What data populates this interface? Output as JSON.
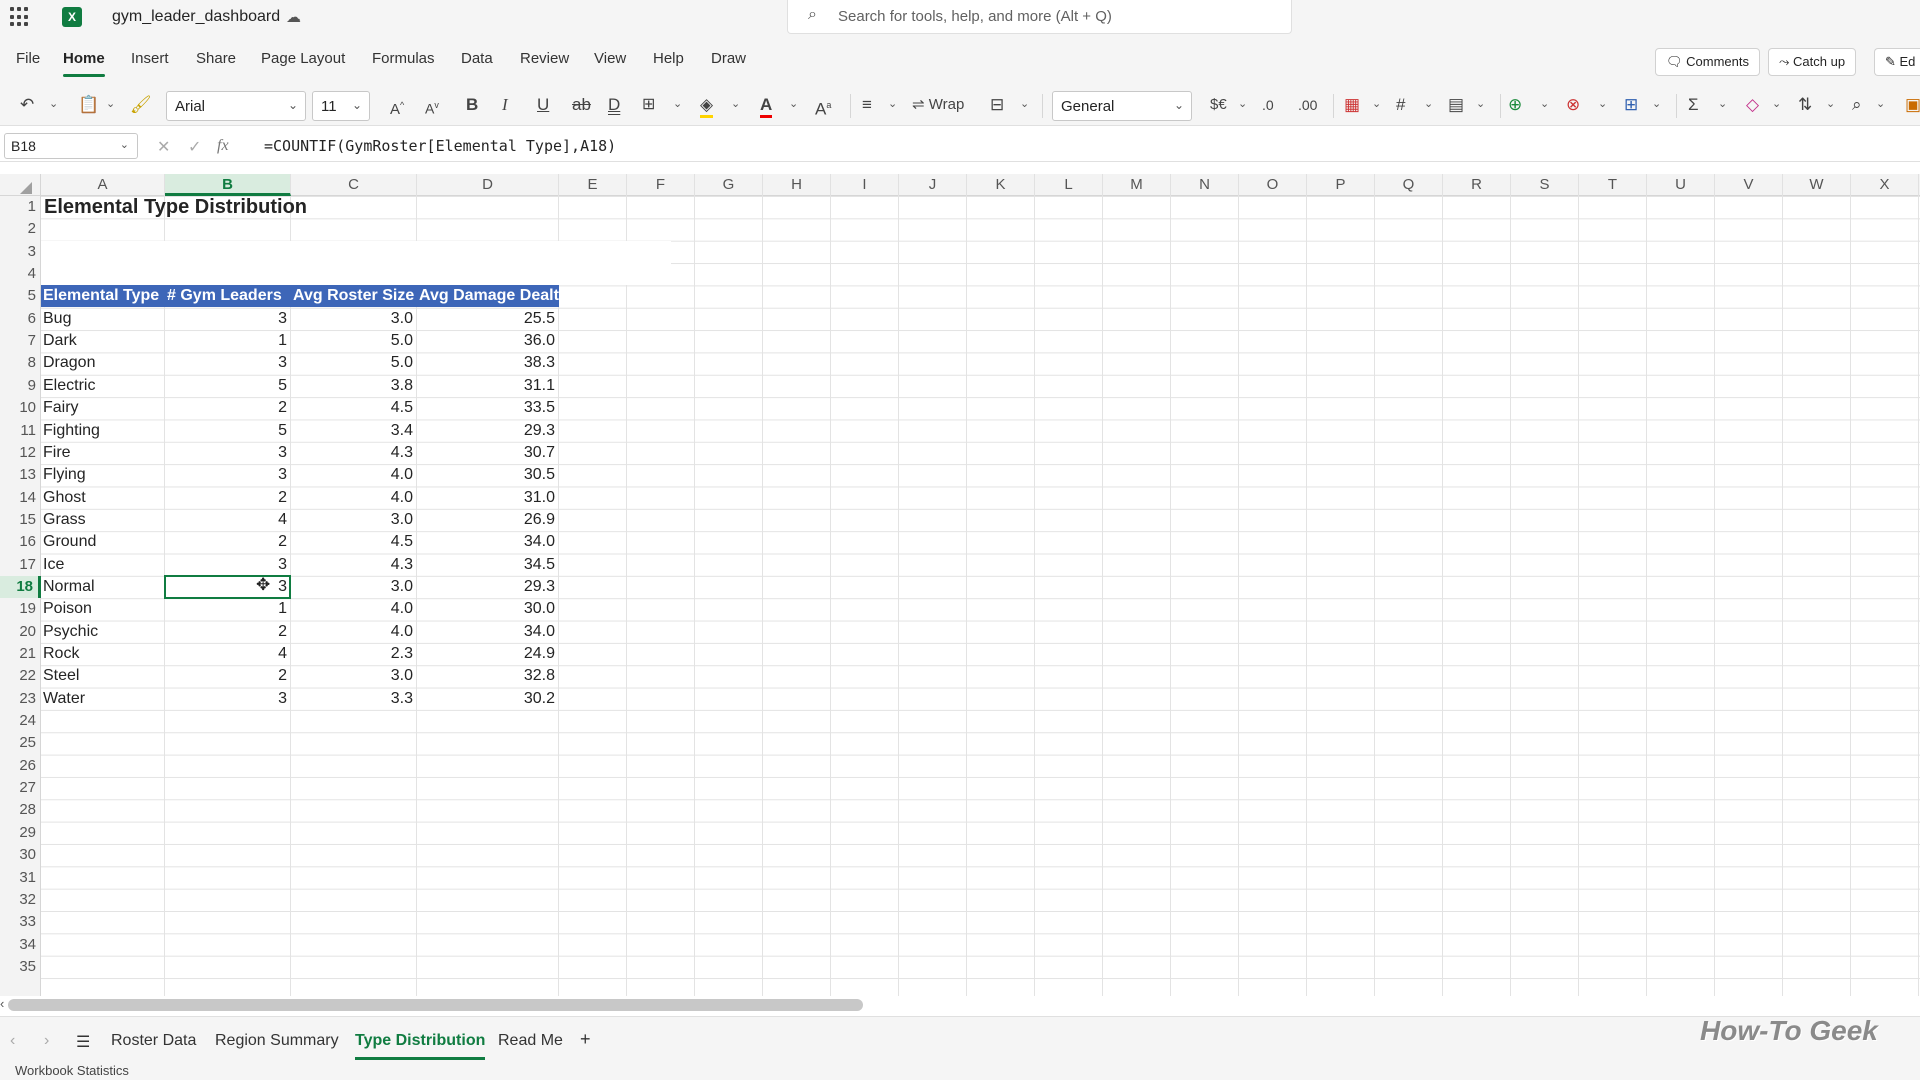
{
  "app": {
    "doc_name": "gym_leader_dashboard",
    "search_placeholder": "Search for tools, help, and more (Alt + Q)"
  },
  "menu": {
    "tabs": [
      "File",
      "Home",
      "Insert",
      "Share",
      "Page Layout",
      "Formulas",
      "Data",
      "Review",
      "View",
      "Help",
      "Draw"
    ],
    "comments": "Comments",
    "catch_up": "Catch up",
    "edit": "Ed"
  },
  "ribbon": {
    "font": "Arial",
    "size": "11",
    "wrap": "Wrap",
    "number_format": "General"
  },
  "formula_bar": {
    "name_box": "B18",
    "formula": "=COUNTIF(GymRoster[Elemental Type],A18)"
  },
  "columns": [
    "A",
    "B",
    "C",
    "D",
    "E",
    "F",
    "G",
    "H",
    "I",
    "J",
    "K",
    "L",
    "M",
    "N",
    "O",
    "P",
    "Q",
    "R",
    "S",
    "T",
    "U",
    "V",
    "W",
    "X"
  ],
  "rows": [
    "1",
    "2",
    "3",
    "4",
    "5",
    "6",
    "7",
    "8",
    "9",
    "10",
    "11",
    "12",
    "13",
    "14",
    "15",
    "16",
    "17",
    "18",
    "19",
    "20",
    "21",
    "22",
    "23",
    "24",
    "25",
    "26",
    "27",
    "28",
    "29",
    "30",
    "31",
    "32",
    "33",
    "34",
    "35"
  ],
  "sheet": {
    "title": "Elemental Type Distribution",
    "headers": [
      "Elemental Type",
      "# Gym Leaders",
      "Avg Roster Size",
      "Avg Damage Dealt"
    ],
    "rows": [
      [
        "Bug",
        "3",
        "3.0",
        "25.5"
      ],
      [
        "Dark",
        "1",
        "5.0",
        "36.0"
      ],
      [
        "Dragon",
        "3",
        "5.0",
        "38.3"
      ],
      [
        "Electric",
        "5",
        "3.8",
        "31.1"
      ],
      [
        "Fairy",
        "2",
        "4.5",
        "33.5"
      ],
      [
        "Fighting",
        "5",
        "3.4",
        "29.3"
      ],
      [
        "Fire",
        "3",
        "4.3",
        "30.7"
      ],
      [
        "Flying",
        "3",
        "4.0",
        "30.5"
      ],
      [
        "Ghost",
        "2",
        "4.0",
        "31.0"
      ],
      [
        "Grass",
        "4",
        "3.0",
        "26.9"
      ],
      [
        "Ground",
        "2",
        "4.5",
        "34.0"
      ],
      [
        "Ice",
        "3",
        "4.3",
        "34.5"
      ],
      [
        "Normal",
        "3",
        "3.0",
        "29.3"
      ],
      [
        "Poison",
        "1",
        "4.0",
        "30.0"
      ],
      [
        "Psychic",
        "2",
        "4.0",
        "34.0"
      ],
      [
        "Rock",
        "4",
        "2.3",
        "24.9"
      ],
      [
        "Steel",
        "2",
        "3.0",
        "32.8"
      ],
      [
        "Water",
        "3",
        "3.3",
        "30.2"
      ]
    ]
  },
  "sheet_tabs": [
    "Roster Data",
    "Region Summary",
    "Type Distribution",
    "Read Me"
  ],
  "status": "Workbook Statistics",
  "watermark": "How-To Geek"
}
